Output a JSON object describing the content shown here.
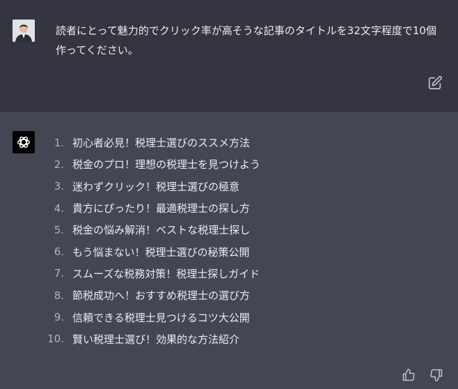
{
  "user": {
    "prompt": "読者にとって魅力的でクリック率が高そうな記事のタイトルを32文字程度で10個作ってください。"
  },
  "assistant": {
    "items": [
      {
        "num": "1.",
        "text": "初心者必見！税理士選びのススメ方法"
      },
      {
        "num": "2.",
        "text": "税金のプロ！理想の税理士を見つけよう"
      },
      {
        "num": "3.",
        "text": "迷わずクリック！税理士選びの極意"
      },
      {
        "num": "4.",
        "text": "貴方にぴったり！最適税理士の探し方"
      },
      {
        "num": "5.",
        "text": "税金の悩み解消！ベストな税理士探し"
      },
      {
        "num": "6.",
        "text": "もう悩まない！税理士選びの秘策公開"
      },
      {
        "num": "7.",
        "text": "スムーズな税務対策！税理士探しガイド"
      },
      {
        "num": "8.",
        "text": "節税成功へ！おすすめ税理士の選び方"
      },
      {
        "num": "9.",
        "text": "信頼できる税理士見つけるコツ大公開"
      },
      {
        "num": "10.",
        "text": "賢い税理士選び！効果的な方法紹介"
      }
    ]
  },
  "icons": {
    "edit": "edit-icon",
    "thumbs_up": "thumbs-up-icon",
    "thumbs_down": "thumbs-down-icon",
    "assistant_logo": "openai-logo-icon"
  },
  "colors": {
    "user_bg": "#343541",
    "assistant_bg": "#444654",
    "text": "#ececf1"
  }
}
